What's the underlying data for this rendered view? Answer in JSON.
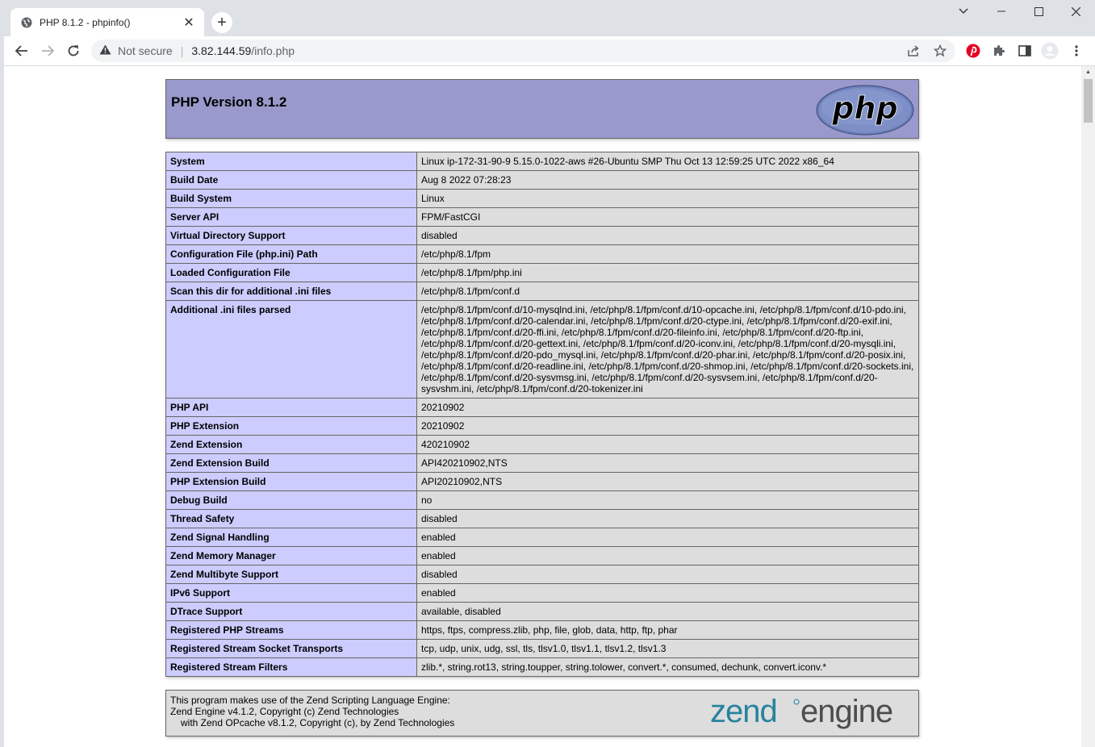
{
  "browser": {
    "tab_title": "PHP 8.1.2 - phpinfo()",
    "security_label": "Not secure",
    "url_host": "3.82.144.59",
    "url_path": "/info.php"
  },
  "page": {
    "version_heading": "PHP Version 8.1.2",
    "logo_text": "php",
    "rows": [
      {
        "key": "System",
        "value": "Linux ip-172-31-90-9 5.15.0-1022-aws #26-Ubuntu SMP Thu Oct 13 12:59:25 UTC 2022 x86_64"
      },
      {
        "key": "Build Date",
        "value": "Aug 8 2022 07:28:23"
      },
      {
        "key": "Build System",
        "value": "Linux"
      },
      {
        "key": "Server API",
        "value": "FPM/FastCGI"
      },
      {
        "key": "Virtual Directory Support",
        "value": "disabled"
      },
      {
        "key": "Configuration File (php.ini) Path",
        "value": "/etc/php/8.1/fpm"
      },
      {
        "key": "Loaded Configuration File",
        "value": "/etc/php/8.1/fpm/php.ini"
      },
      {
        "key": "Scan this dir for additional .ini files",
        "value": "/etc/php/8.1/fpm/conf.d"
      },
      {
        "key": "Additional .ini files parsed",
        "value": "/etc/php/8.1/fpm/conf.d/10-mysqlnd.ini, /etc/php/8.1/fpm/conf.d/10-opcache.ini, /etc/php/8.1/fpm/conf.d/10-pdo.ini, /etc/php/8.1/fpm/conf.d/20-calendar.ini, /etc/php/8.1/fpm/conf.d/20-ctype.ini, /etc/php/8.1/fpm/conf.d/20-exif.ini, /etc/php/8.1/fpm/conf.d/20-ffi.ini, /etc/php/8.1/fpm/conf.d/20-fileinfo.ini, /etc/php/8.1/fpm/conf.d/20-ftp.ini, /etc/php/8.1/fpm/conf.d/20-gettext.ini, /etc/php/8.1/fpm/conf.d/20-iconv.ini, /etc/php/8.1/fpm/conf.d/20-mysqli.ini, /etc/php/8.1/fpm/conf.d/20-pdo_mysql.ini, /etc/php/8.1/fpm/conf.d/20-phar.ini, /etc/php/8.1/fpm/conf.d/20-posix.ini, /etc/php/8.1/fpm/conf.d/20-readline.ini, /etc/php/8.1/fpm/conf.d/20-shmop.ini, /etc/php/8.1/fpm/conf.d/20-sockets.ini, /etc/php/8.1/fpm/conf.d/20-sysvmsg.ini, /etc/php/8.1/fpm/conf.d/20-sysvsem.ini, /etc/php/8.1/fpm/conf.d/20-sysvshm.ini, /etc/php/8.1/fpm/conf.d/20-tokenizer.ini"
      },
      {
        "key": "PHP API",
        "value": "20210902"
      },
      {
        "key": "PHP Extension",
        "value": "20210902"
      },
      {
        "key": "Zend Extension",
        "value": "420210902"
      },
      {
        "key": "Zend Extension Build",
        "value": "API420210902,NTS"
      },
      {
        "key": "PHP Extension Build",
        "value": "API20210902,NTS"
      },
      {
        "key": "Debug Build",
        "value": "no"
      },
      {
        "key": "Thread Safety",
        "value": "disabled"
      },
      {
        "key": "Zend Signal Handling",
        "value": "enabled"
      },
      {
        "key": "Zend Memory Manager",
        "value": "enabled"
      },
      {
        "key": "Zend Multibyte Support",
        "value": "disabled"
      },
      {
        "key": "IPv6 Support",
        "value": "enabled"
      },
      {
        "key": "DTrace Support",
        "value": "available, disabled"
      },
      {
        "key": "Registered PHP Streams",
        "value": "https, ftps, compress.zlib, php, file, glob, data, http, ftp, phar"
      },
      {
        "key": "Registered Stream Socket Transports",
        "value": "tcp, udp, unix, udg, ssl, tls, tlsv1.0, tlsv1.1, tlsv1.2, tlsv1.3"
      },
      {
        "key": "Registered Stream Filters",
        "value": "zlib.*, string.rot13, string.toupper, string.tolower, convert.*, consumed, dechunk, convert.iconv.*"
      }
    ],
    "zend": {
      "line1": "This program makes use of the Zend Scripting Language Engine:",
      "line2": "Zend Engine v4.1.2, Copyright (c) Zend Technologies",
      "line3": "with Zend OPcache v8.1.2, Copyright (c), by Zend Technologies",
      "logo_word1": "zend",
      "logo_word2": "engine"
    }
  },
  "colors": {
    "header_bg": "#9999cc",
    "key_bg": "#ccccff",
    "value_bg": "#dddddd",
    "zend_teal": "#27839d",
    "zend_gray": "#4d4d4f"
  }
}
